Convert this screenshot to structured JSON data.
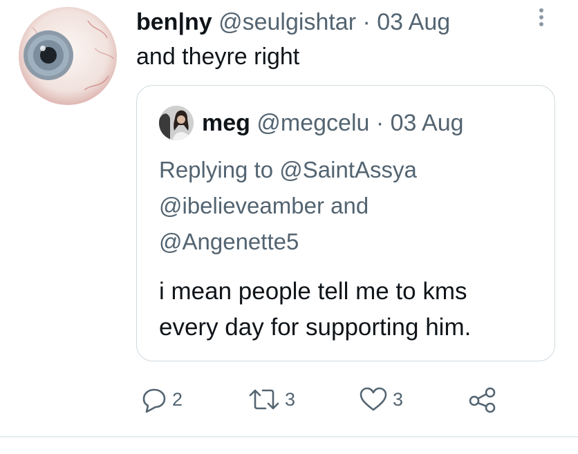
{
  "tweet": {
    "display_name": "ben|ny",
    "handle": "@seulgishtar",
    "separator": "·",
    "date": "03 Aug",
    "text": "and theyre right",
    "avatar_icon": "eyeball-avatar"
  },
  "quoted": {
    "display_name": "meg",
    "handle": "@megcelu",
    "separator": "·",
    "date": "03 Aug",
    "reply_line1": "Replying to @SaintAssya",
    "reply_line2": "@ibelieveamber and",
    "reply_line3": "@Angenette5",
    "text_line1": "i mean people tell me to kms",
    "text_line2": "every day for supporting him."
  },
  "actions": {
    "reply_count": "2",
    "retweet_count": "3",
    "like_count": "3"
  },
  "colors": {
    "text": "#0f1419",
    "muted": "#536471",
    "border": "#cfd9de"
  }
}
